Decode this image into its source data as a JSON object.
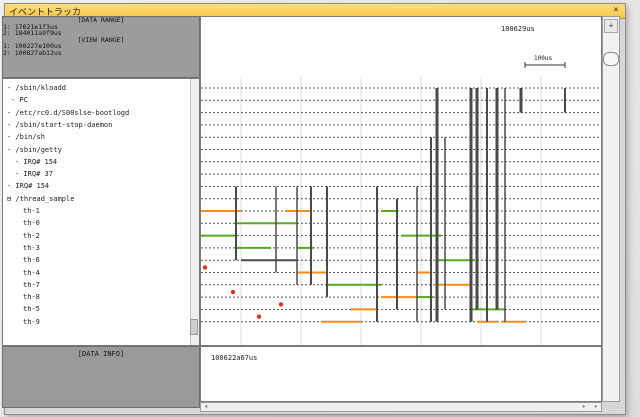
{
  "window": {
    "title": "イベントトラッカ"
  },
  "info_panel": {
    "data_range_header": "[DATA RANGE]",
    "data_range_lines": [
      "1: 17621e1f3us",
      "2: 184011a9f9us"
    ],
    "view_range_header": "[VIEW RANGE]",
    "view_range_lines": [
      "1: 100227e100us",
      "2: 100827ab12us"
    ]
  },
  "tree": {
    "items": [
      {
        "label": "/sbin/kloadd"
      },
      {
        "label": "PC"
      },
      {
        "label": "/etc/rc0.d/S00slse-bootlogd"
      },
      {
        "label": "/sbin/start-stop-daemon"
      },
      {
        "label": "/bin/sh"
      },
      {
        "label": "/sbin/getty"
      },
      {
        "label": "IRQ# 154"
      },
      {
        "label": "IRQ# 37"
      },
      {
        "label": "IRQ# 154"
      },
      {
        "label": "/thread_sample"
      },
      {
        "label": "th-1"
      },
      {
        "label": "th-0"
      },
      {
        "label": "th-2"
      },
      {
        "label": "th-3"
      },
      {
        "label": "th-6"
      },
      {
        "label": "th-4"
      },
      {
        "label": "th-7"
      },
      {
        "label": "th-8"
      },
      {
        "label": "th-5"
      },
      {
        "label": "th-9"
      }
    ]
  },
  "data_info": {
    "title": "[DATA INFO]"
  },
  "chart": {
    "time_label": "100629us",
    "scale_label": "100us",
    "colors": {
      "running": "#55aa22",
      "waiting": "#ff8c1a",
      "switch": "#4a4a4a",
      "marker": "#e03020",
      "lane": "#555555",
      "grid": "#dddddd"
    }
  },
  "readout": {
    "value": "100622a67us"
  },
  "chart_data": {
    "type": "gantt",
    "title": "",
    "lanes": [
      "/sbin/kloadd",
      "PC",
      "/etc/rc0.d/S00slse-bootlogd",
      "/sbin/start-stop-daemon",
      "/bin/sh",
      "/sbin/getty",
      "IRQ# 154",
      "IRQ# 37",
      "IRQ# 154",
      "/thread_sample",
      "th-1",
      "th-0",
      "th-2",
      "th-3",
      "th-6",
      "th-4",
      "th-7",
      "th-8",
      "th-5",
      "th-9"
    ]
  }
}
